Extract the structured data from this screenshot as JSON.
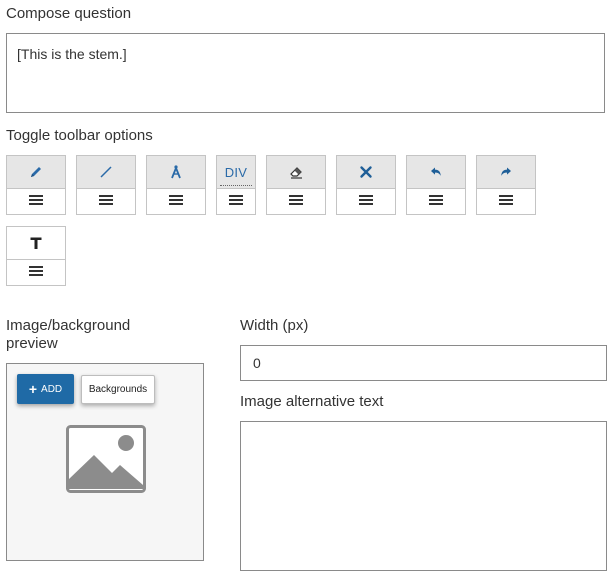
{
  "compose": {
    "label": "Compose question",
    "stem_text": "[This is the stem.]"
  },
  "toolbar": {
    "label": "Toggle toolbar options",
    "div_label": "DIV",
    "tools": [
      {
        "name": "pencil",
        "icon": "pencil-icon"
      },
      {
        "name": "line",
        "icon": "line-icon"
      },
      {
        "name": "compass",
        "icon": "compass-icon"
      },
      {
        "name": "div",
        "icon": "div-text"
      },
      {
        "name": "eraser",
        "icon": "eraser-icon"
      },
      {
        "name": "clear",
        "icon": "close-icon"
      },
      {
        "name": "undo",
        "icon": "undo-icon"
      },
      {
        "name": "redo",
        "icon": "redo-icon"
      },
      {
        "name": "text",
        "icon": "text-icon"
      }
    ]
  },
  "preview": {
    "label_line1": "Image/background",
    "label_line2": "preview",
    "add_label": "ADD",
    "backgrounds_label": "Backgrounds"
  },
  "width": {
    "label": "Width (px)",
    "value": "0"
  },
  "alt_text": {
    "label": "Image alternative text",
    "value": ""
  },
  "colors": {
    "accent": "#1f6aa6",
    "icon": "#2a6aa8",
    "tool_header": "#e6e6e6",
    "border": "#8a8a8a"
  }
}
